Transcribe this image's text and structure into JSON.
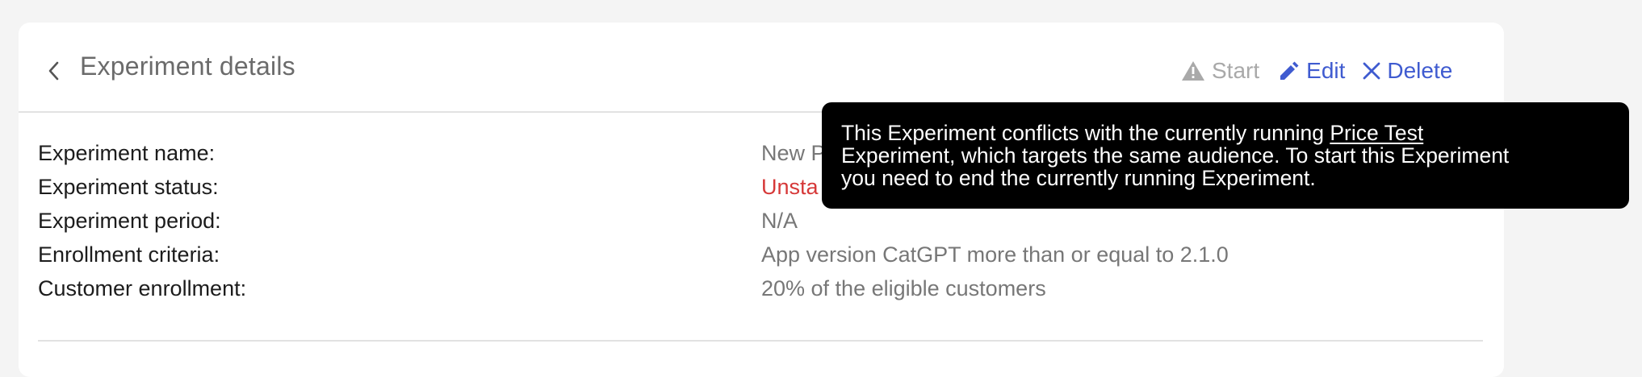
{
  "header": {
    "title": "Experiment details",
    "actions": {
      "start": "Start",
      "edit": "Edit",
      "delete": "Delete"
    }
  },
  "details": [
    {
      "label": "Experiment name:",
      "value": "New P"
    },
    {
      "label": "Experiment status:",
      "value": "Unsta"
    },
    {
      "label": "Experiment period:",
      "value": "N/A"
    },
    {
      "label": "Enrollment criteria:",
      "value": "App version CatGPT more than or equal to 2.1.0"
    },
    {
      "label": "Customer enrollment:",
      "value": "20% of the eligible customers"
    }
  ],
  "tooltip": {
    "line1_prefix": "This Experiment conflicts with the currently running ",
    "link_text": "Price Test",
    "line2": "Experiment, which targets the same audience. To start this Experiment",
    "line3": "you need to end the currently running Experiment."
  },
  "colors": {
    "accent": "#3f5bd0",
    "disabled": "#a9a9a9",
    "status_error": "#d63838",
    "tooltip_bg": "#000000"
  },
  "icons": {
    "back": "chevron-left-icon",
    "start": "warning-icon",
    "edit": "pencil-icon",
    "delete": "close-icon"
  }
}
